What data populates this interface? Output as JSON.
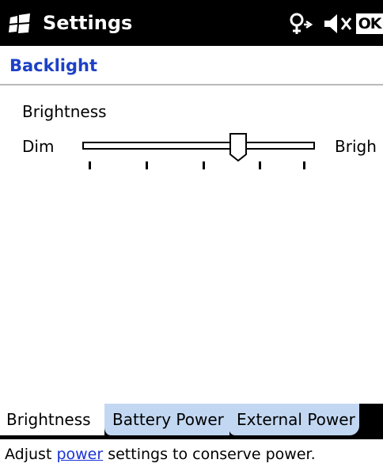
{
  "titlebar": {
    "title": "Settings",
    "ok_label": "OK",
    "icons": [
      "windows-start-icon",
      "connectivity-icon",
      "volume-muted-icon"
    ]
  },
  "header": {
    "title": "Backlight"
  },
  "brightness": {
    "section_label": "Brightness",
    "min_label": "Dim",
    "max_label": "Brigh",
    "slider_level_fraction": 0.67,
    "tick_count": 5
  },
  "tabs": [
    {
      "label": "Brightness",
      "active": true
    },
    {
      "label": "Battery Power",
      "active": false
    },
    {
      "label": "External Power",
      "active": false
    }
  ],
  "footer": {
    "prefix": "Adjust ",
    "link_label": "power",
    "suffix": " settings to conserve power."
  },
  "colors": {
    "title_blue": "#1c41c6",
    "tab_inactive": "#c2d7f2",
    "link_blue": "#1a33d6"
  }
}
